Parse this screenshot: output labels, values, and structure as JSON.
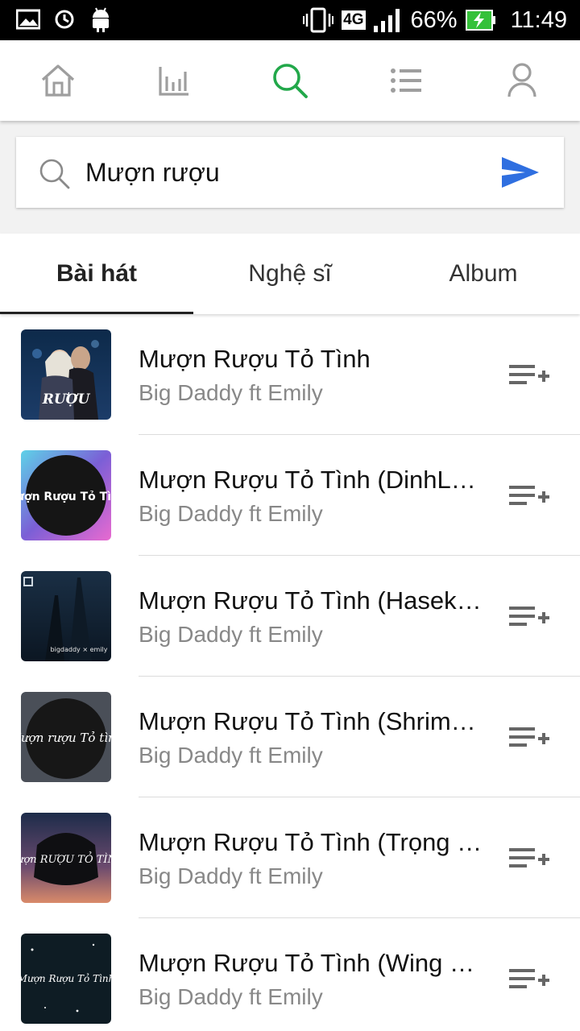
{
  "status_bar": {
    "network": "4G",
    "battery": "66%",
    "time": "11:49"
  },
  "nav": {
    "icons": [
      "home-icon",
      "chart-icon",
      "search-icon",
      "list-icon",
      "user-icon"
    ],
    "active_color": "#22a84a",
    "inactive_color": "#9e9e9e"
  },
  "search": {
    "query": "Mượn rượu",
    "send_color": "#2f6fe0"
  },
  "tabs": [
    {
      "label": "Bài hát",
      "active": true
    },
    {
      "label": "Nghệ sĩ",
      "active": false
    },
    {
      "label": "Album",
      "active": false
    }
  ],
  "songs": [
    {
      "title": "Mượn Rượu Tỏ Tình",
      "artist": "Big Daddy ft Emily"
    },
    {
      "title": "Mượn Rượu Tỏ Tình (DinhLong Remix)",
      "artist": "Big Daddy ft Emily"
    },
    {
      "title": "Mượn Rượu Tỏ Tình (Hasekuro Remix)",
      "artist": "Big Daddy ft Emily"
    },
    {
      "title": "Mượn Rượu Tỏ Tình (Shrimp Remix)",
      "artist": "Big Daddy ft Emily"
    },
    {
      "title": "Mượn Rượu Tỏ Tình (Trọng Hiếu Remix)",
      "artist": "Big Daddy ft Emily"
    },
    {
      "title": "Mượn Rượu Tỏ Tình (Wing Remix)",
      "artist": "Big Daddy ft Emily"
    }
  ],
  "covers": [
    {
      "text": "RƯỢU"
    },
    {
      "text": "Mượn Rượu Tỏ Tình"
    },
    {
      "text": "bigdaddy × emily"
    },
    {
      "text": "Mượn rượu Tỏ tình"
    },
    {
      "text": "Mượn RƯỢU TỎ TÌNH"
    },
    {
      "text": "Mượn Rượu Tỏ Tình"
    }
  ]
}
